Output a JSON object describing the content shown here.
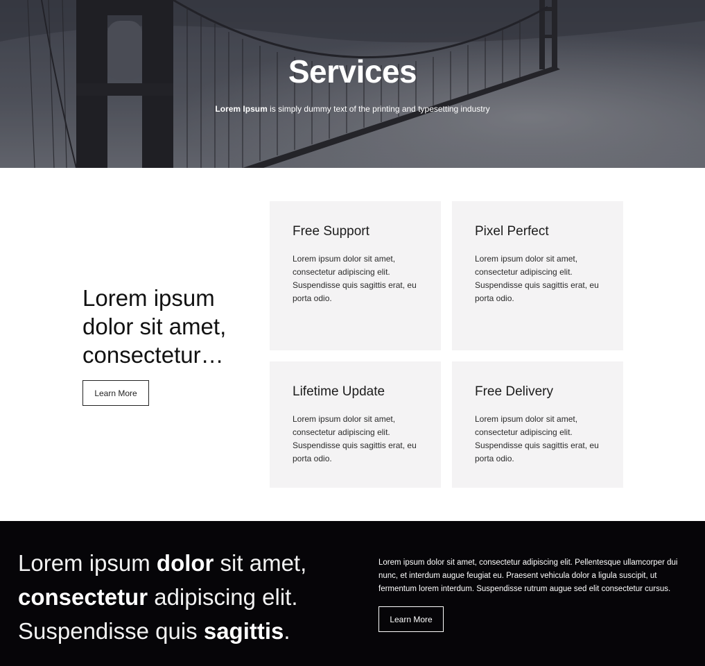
{
  "hero": {
    "title": "Services",
    "subtitle_bold": "Lorem Ipsum",
    "subtitle_rest": " is simply dummy text of the printing and typesetting industry"
  },
  "services": {
    "lead": "Lorem ipsum dolor sit amet, consectetur…",
    "button": "Learn More",
    "cards": [
      {
        "title": "Free Support",
        "text": "Lorem ipsum dolor sit amet, consectetur adipiscing elit. Suspendisse quis sagittis erat, eu porta odio."
      },
      {
        "title": "Pixel Perfect",
        "text": "Lorem ipsum dolor sit amet, consectetur adipiscing elit. Suspendisse quis sagittis erat, eu porta odio."
      },
      {
        "title": "Lifetime Update",
        "text": "Lorem ipsum dolor sit amet, consectetur adipiscing elit. Suspendisse quis sagittis erat, eu porta odio."
      },
      {
        "title": "Free Delivery",
        "text": "Lorem ipsum dolor sit amet, consectetur adipiscing elit. Suspendisse quis sagittis erat, eu porta odio."
      }
    ]
  },
  "band": {
    "big": {
      "p1": "Lorem ipsum ",
      "b1": "dolor",
      "p2": " sit amet,",
      "b2": "consectetur",
      "p3": " adipiscing elit.",
      "p4": "Suspendisse quis ",
      "b3": "sagittis",
      "p5": "."
    },
    "paragraph": "Lorem ipsum dolor sit amet, consectetur adipiscing elit. Pellentesque ullamcorper dui nunc, et interdum augue feugiat eu. Praesent vehicula dolor a ligula suscipit, ut fermentum lorem interdum. Suspendisse rutrum augue sed elit consectetur cursus.",
    "button": "Learn More"
  },
  "colors": {
    "card_bg": "#f4f3f4",
    "band_bg": "#060508",
    "hero_overlay": "#3a3d48"
  }
}
